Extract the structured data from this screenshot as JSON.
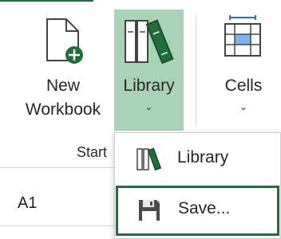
{
  "ribbon": {
    "new_workbook": {
      "line1": "New",
      "line2": "Workbook"
    },
    "library": {
      "label": "Library",
      "chevron": "⌄"
    },
    "cells": {
      "label": "Cells",
      "chevron": "⌄"
    },
    "group_label": "Start"
  },
  "name_box": {
    "value": "A1"
  },
  "library_menu": {
    "items": [
      {
        "label": "Library",
        "icon": "books-icon"
      },
      {
        "label": "Save...",
        "icon": "floppy-disk-icon",
        "highlighted": true
      }
    ]
  },
  "colors": {
    "accent": "#1e6f3c",
    "selected_button": "#a9d2b6",
    "plus_badge": "#1f6e3b"
  }
}
